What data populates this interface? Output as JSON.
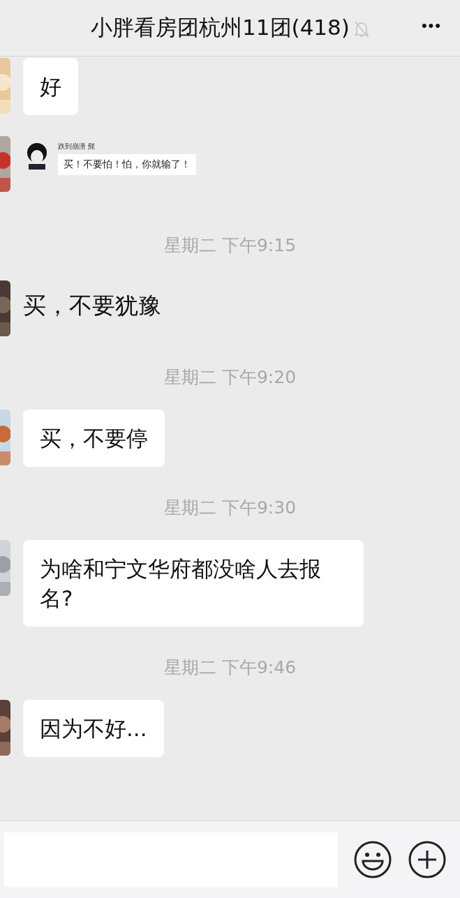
{
  "header": {
    "title": "小胖看房团杭州11团(418)",
    "muted": true,
    "more": "•••"
  },
  "messages": [
    {
      "kind": "bubble",
      "text": "好"
    },
    {
      "kind": "sticker",
      "name": "跌到崩溃 髭",
      "text": "买！不要怕！怕，你就输了！"
    },
    {
      "kind": "time",
      "text": "星期二 下午9:15"
    },
    {
      "kind": "plain",
      "text": "买，不要犹豫"
    },
    {
      "kind": "time",
      "text": "星期二 下午9:20"
    },
    {
      "kind": "bubble",
      "text": "买，不要停"
    },
    {
      "kind": "time",
      "text": "星期二 下午9:30"
    },
    {
      "kind": "bubble",
      "text": " 为啥和宁文华府都没啥人去报名?"
    },
    {
      "kind": "time",
      "text": "星期二 下午9:46"
    },
    {
      "kind": "bubble",
      "text": "因为不好..."
    }
  ]
}
